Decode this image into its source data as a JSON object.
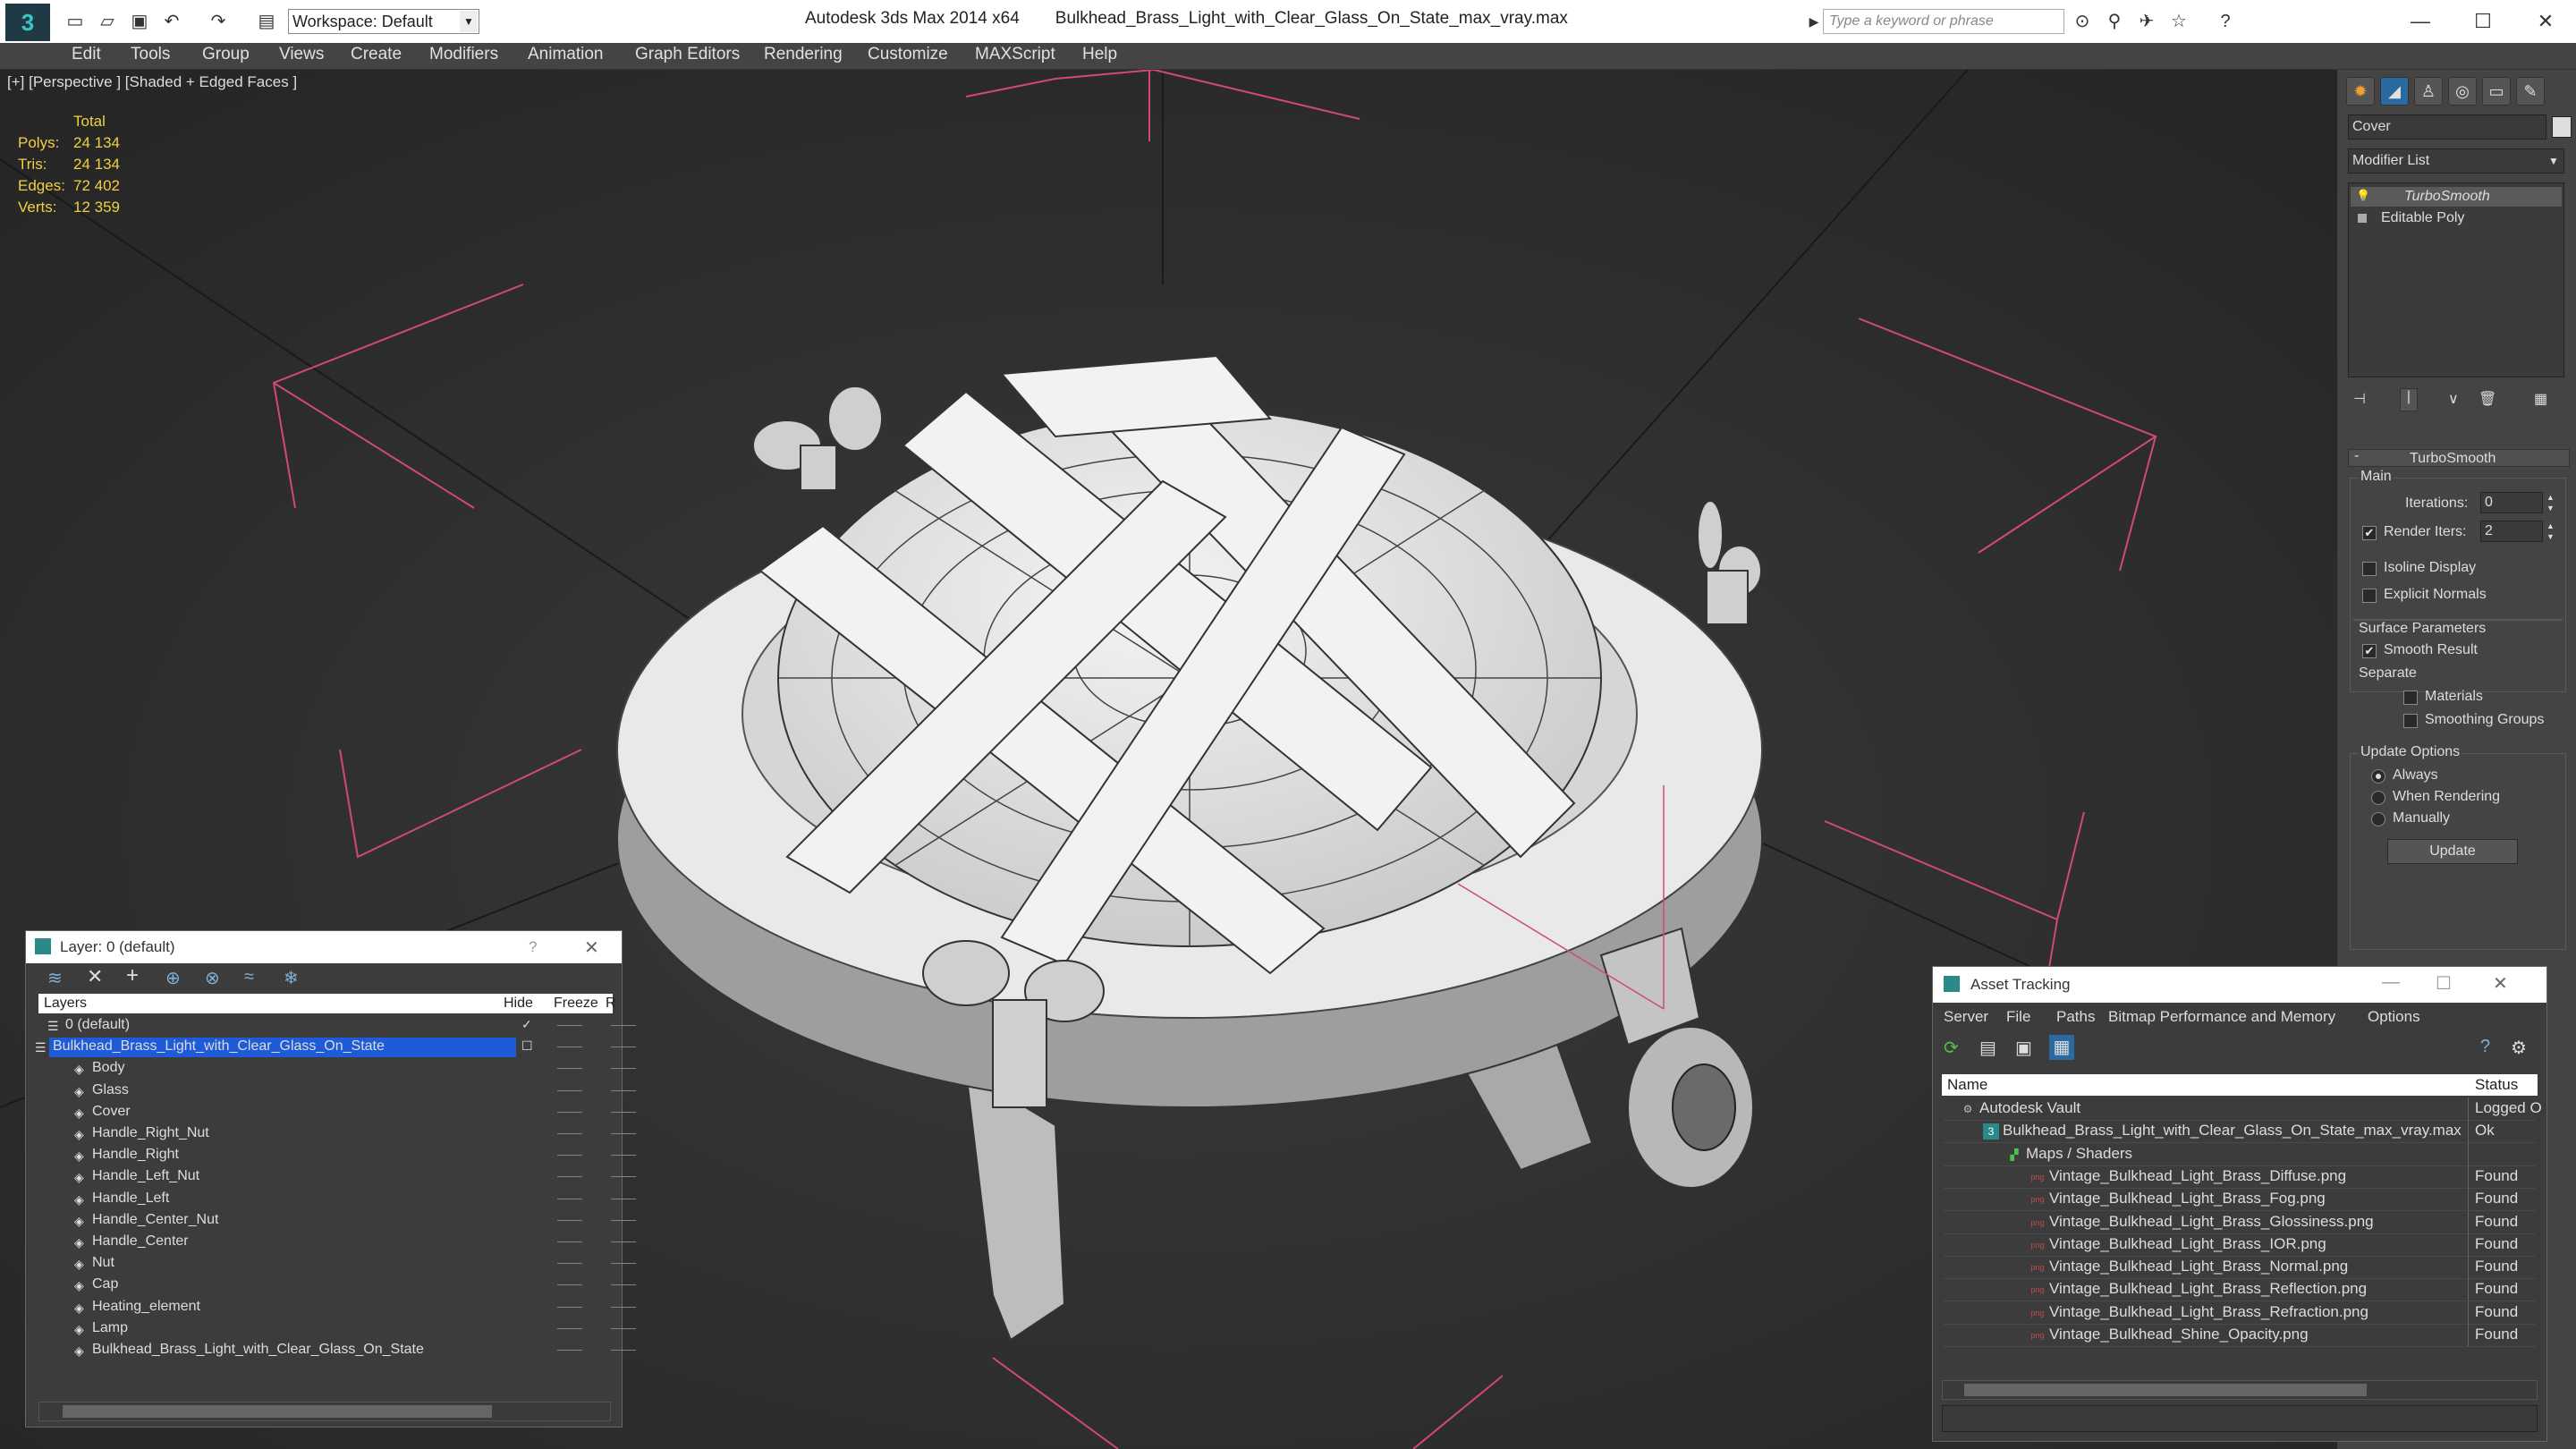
{
  "titlebar": {
    "app_title": "Autodesk 3ds Max 2014 x64",
    "file_name": "Bulkhead_Brass_Light_with_Clear_Glass_On_State_max_vray.max",
    "workspace_label": "Workspace: Default",
    "search_placeholder": "Type a keyword or phrase",
    "logo_glyph": "3",
    "minimize": "—",
    "maximize": "☐",
    "close": "✕"
  },
  "menu": [
    "Edit",
    "Tools",
    "Group",
    "Views",
    "Create",
    "Modifiers",
    "Animation",
    "Graph Editors",
    "Rendering",
    "Customize",
    "MAXScript",
    "Help"
  ],
  "viewport": {
    "label": "[+] [Perspective ] [Shaded + Edged Faces ]",
    "stats": {
      "header": "Total",
      "polys_label": "Polys:",
      "polys": "24 134",
      "tris_label": "Tris:",
      "tris": "24 134",
      "edges_label": "Edges:",
      "edges": "72 402",
      "verts_label": "Verts:",
      "verts": "12 359"
    }
  },
  "command_panel": {
    "object_name": "Cover",
    "modifier_list": "Modifier List",
    "stack": [
      "TurboSmooth",
      "Editable Poly"
    ],
    "rollout_title": "TurboSmooth",
    "main_label": "Main",
    "iterations_label": "Iterations:",
    "iterations": "0",
    "render_iters_label": "Render Iters:",
    "render_iters": "2",
    "isoline": "Isoline Display",
    "explicit_normals": "Explicit Normals",
    "surface_params": "Surface Parameters",
    "smooth_result": "Smooth Result",
    "separate": "Separate",
    "materials": "Materials",
    "smoothing_groups": "Smoothing Groups",
    "update_options": "Update Options",
    "always": "Always",
    "when_rendering": "When Rendering",
    "manually": "Manually",
    "update_button": "Update"
  },
  "layer_window": {
    "title": "Layer: 0 (default)",
    "help": "?",
    "close": "✕",
    "col_layers": "Layers",
    "col_hide": "Hide",
    "col_freeze": "Freeze",
    "col_render": "R",
    "rows": [
      {
        "name": "0 (default)",
        "kind": "layer"
      },
      {
        "name": "Bulkhead_Brass_Light_with_Clear_Glass_On_State",
        "kind": "layer-selected"
      },
      {
        "name": "Body",
        "kind": "object"
      },
      {
        "name": "Glass",
        "kind": "object"
      },
      {
        "name": "Cover",
        "kind": "object"
      },
      {
        "name": "Handle_Right_Nut",
        "kind": "object"
      },
      {
        "name": "Handle_Right",
        "kind": "object"
      },
      {
        "name": "Handle_Left_Nut",
        "kind": "object"
      },
      {
        "name": "Handle_Left",
        "kind": "object"
      },
      {
        "name": "Handle_Center_Nut",
        "kind": "object"
      },
      {
        "name": "Handle_Center",
        "kind": "object"
      },
      {
        "name": "Nut",
        "kind": "object"
      },
      {
        "name": "Cap",
        "kind": "object"
      },
      {
        "name": "Heating_element",
        "kind": "object"
      },
      {
        "name": "Lamp",
        "kind": "object"
      },
      {
        "name": "Bulkhead_Brass_Light_with_Clear_Glass_On_State",
        "kind": "object"
      }
    ]
  },
  "asset_window": {
    "title": "Asset Tracking",
    "menus": [
      "Server",
      "File",
      "Paths",
      "Bitmap Performance and Memory",
      "Options"
    ],
    "col_name": "Name",
    "col_status": "Status",
    "rows": [
      {
        "name": "Autodesk Vault",
        "status": "Logged O",
        "indent": 0,
        "icon": "vault"
      },
      {
        "name": "Bulkhead_Brass_Light_with_Clear_Glass_On_State_max_vray.max",
        "status": "Ok",
        "indent": 1,
        "icon": "max"
      },
      {
        "name": "Maps / Shaders",
        "status": "",
        "indent": 2,
        "icon": "maps"
      },
      {
        "name": "Vintage_Bulkhead_Light_Brass_Diffuse.png",
        "status": "Found",
        "indent": 3,
        "icon": "png"
      },
      {
        "name": "Vintage_Bulkhead_Light_Brass_Fog.png",
        "status": "Found",
        "indent": 3,
        "icon": "png"
      },
      {
        "name": "Vintage_Bulkhead_Light_Brass_Glossiness.png",
        "status": "Found",
        "indent": 3,
        "icon": "png"
      },
      {
        "name": "Vintage_Bulkhead_Light_Brass_IOR.png",
        "status": "Found",
        "indent": 3,
        "icon": "png"
      },
      {
        "name": "Vintage_Bulkhead_Light_Brass_Normal.png",
        "status": "Found",
        "indent": 3,
        "icon": "png"
      },
      {
        "name": "Vintage_Bulkhead_Light_Brass_Reflection.png",
        "status": "Found",
        "indent": 3,
        "icon": "png"
      },
      {
        "name": "Vintage_Bulkhead_Light_Brass_Refraction.png",
        "status": "Found",
        "indent": 3,
        "icon": "png"
      },
      {
        "name": "Vintage_Bulkhead_Shine_Opacity.png",
        "status": "Found",
        "indent": 3,
        "icon": "png"
      }
    ]
  },
  "colors": {
    "selection": "#1e5bd8",
    "stats": "#f0d040",
    "grid_pink": "#e06080"
  }
}
